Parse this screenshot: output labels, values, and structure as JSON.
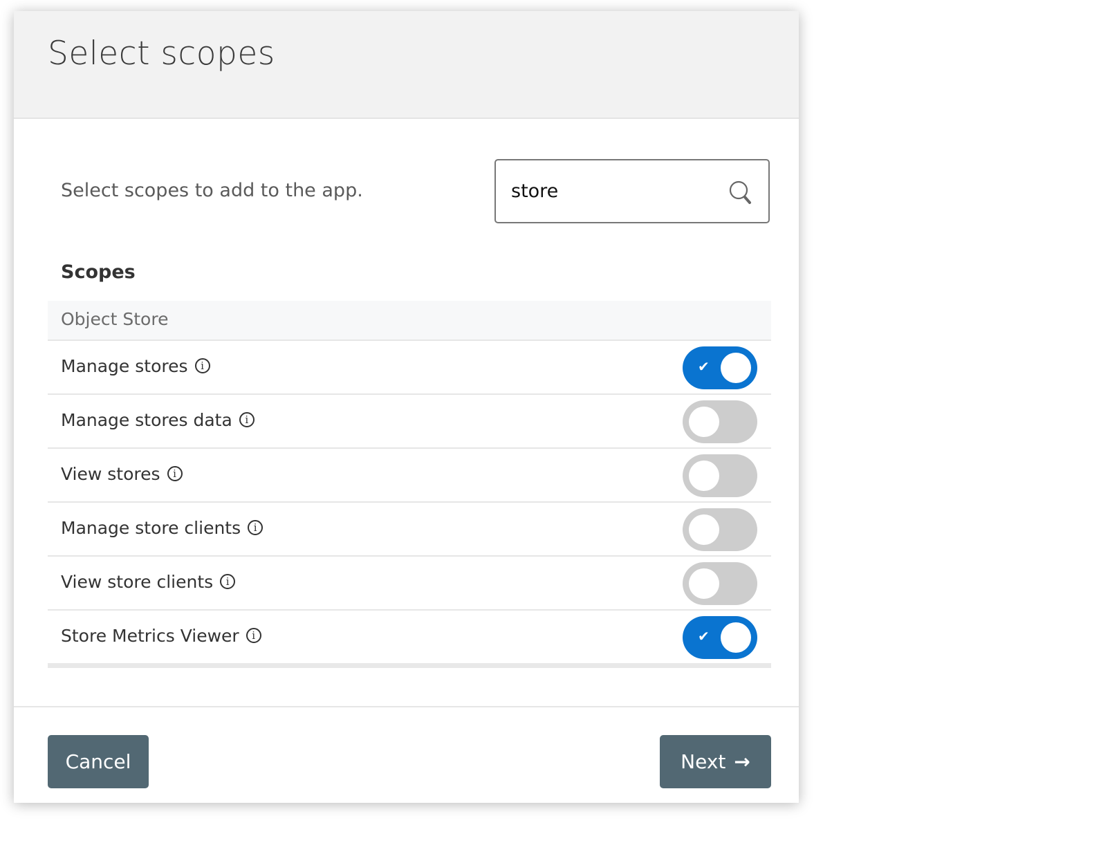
{
  "modal": {
    "title": "Select scopes",
    "intro": "Select scopes to add to the app.",
    "search": {
      "value": "store",
      "placeholder": "",
      "icon": "search-icon"
    },
    "section_title": "Scopes",
    "groups": [
      {
        "label": "Object Store",
        "scopes": [
          {
            "label": "Manage stores",
            "enabled": true
          },
          {
            "label": "Manage stores data",
            "enabled": false
          },
          {
            "label": "View stores",
            "enabled": false
          },
          {
            "label": "Manage store clients",
            "enabled": false
          },
          {
            "label": "View store clients",
            "enabled": false
          },
          {
            "label": "Store Metrics Viewer",
            "enabled": true
          }
        ]
      }
    ],
    "info_glyph": "i",
    "check_glyph": "✔",
    "footer": {
      "cancel_label": "Cancel",
      "next_label": "Next",
      "next_arrow": "→"
    },
    "colors": {
      "toggle_on": "#0a74d0",
      "toggle_off": "#cdcdcd",
      "button": "#526873"
    }
  }
}
